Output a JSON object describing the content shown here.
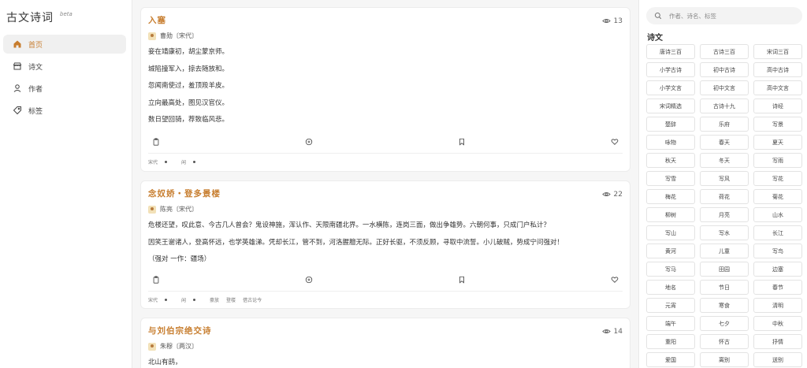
{
  "app": {
    "title": "古文诗词",
    "badge": "beta"
  },
  "nav": [
    {
      "label": "首页",
      "icon": "home-icon",
      "active": true
    },
    {
      "label": "诗文",
      "icon": "shop-icon",
      "active": false
    },
    {
      "label": "作者",
      "icon": "user-icon",
      "active": false
    },
    {
      "label": "标签",
      "icon": "tag-icon",
      "active": false
    }
  ],
  "poems": [
    {
      "title": "入塞",
      "views": "13",
      "author": "曹勋〔宋代〕",
      "lines": [
        "妾在靖康初，胡尘蒙京师。",
        "城陷撞军入，掠去随放和。",
        "忽闻南使过，羞顶羖羊皮。",
        "立向最高处，图见汉官仪。",
        "数日望回骑，荐致临风悲。"
      ],
      "tags": [
        "宋代",
        "闲"
      ]
    },
    {
      "title": "念奴娇・登多景楼",
      "views": "22",
      "author": "陈亮〔宋代〕",
      "lines": [
        "危楼还望，叹此意、今古几人曾会？鬼设神施，浑认作、天限南疆北界。一水横陈，连岗三面，做出争雄势。六朝何事，只成门户私计？",
        "因笑王谢诸人，登高怀远，也学英雄涕。凭却长江，管不到，河洛腥膻无际。正好长驱，不须反顾，寻取中流誓。小儿破贼，势成宁问强对！",
        "（强对 一作：疆场）"
      ],
      "tags": [
        "宋代",
        "闲",
        "豪放",
        "登楼",
        "借古论今"
      ]
    },
    {
      "title": "与刘伯宗绝交诗",
      "views": "14",
      "author": "朱穆〔两汉〕",
      "lines": [
        "北山有鸱，"
      ]
    }
  ],
  "sidebar_right": {
    "search_placeholder": "作者、诗名、标签",
    "section_title": "诗文",
    "chips": [
      "唐诗三百",
      "古诗三百",
      "宋词三百",
      "小学古诗",
      "初中古诗",
      "高中古诗",
      "小学文言",
      "初中文言",
      "高中文言",
      "宋词精选",
      "古诗十九",
      "诗经",
      "楚辞",
      "乐府",
      "写景",
      "咏物",
      "春天",
      "夏天",
      "秋天",
      "冬天",
      "写雨",
      "写雪",
      "写风",
      "写花",
      "梅花",
      "荷花",
      "菊花",
      "柳树",
      "月亮",
      "山水",
      "写山",
      "写水",
      "长江",
      "黄河",
      "儿童",
      "写鸟",
      "写马",
      "田园",
      "边塞",
      "地名",
      "节日",
      "春节",
      "元宵",
      "寒食",
      "清明",
      "端午",
      "七夕",
      "中秋",
      "重阳",
      "怀古",
      "抒情",
      "爱国",
      "离别",
      "送别"
    ]
  },
  "colors": {
    "accent": "#c77d2e",
    "background": "#f6f6f6"
  }
}
